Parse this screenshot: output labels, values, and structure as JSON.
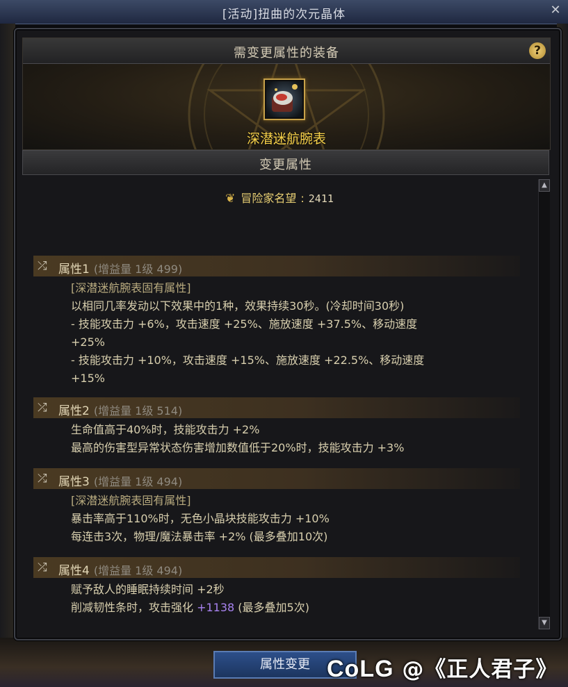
{
  "window": {
    "title": "[活动]扭曲的次元晶体",
    "close_label": "✕"
  },
  "equip_section": {
    "title": "需变更属性的装备",
    "help_label": "?",
    "item_name": "深潜迷航腕表"
  },
  "attr_section": {
    "title": "变更属性"
  },
  "fame": {
    "label": "冒险家名望",
    "separator": ":",
    "value": "2411"
  },
  "attributes": [
    {
      "label": "属性1",
      "extra": "(增益量 1级 499)",
      "lines": [
        "[深潜迷航腕表固有属性]",
        "以相同几率发动以下效果中的1种，效果持续30秒。(冷却时间30秒)",
        "- 技能攻击力 +6%，攻击速度 +25%、施放速度 +37.5%、移动速度",
        "+25%",
        "- 技能攻击力 +10%，攻击速度 +15%、施放速度 +22.5%、移动速度",
        "+15%"
      ]
    },
    {
      "label": "属性2",
      "extra": "(增益量 1级 514)",
      "lines": [
        "生命值高于40%时，技能攻击力 +2%",
        "最高的伤害型异常状态伤害增加数值低于20%时，技能攻击力 +3%"
      ]
    },
    {
      "label": "属性3",
      "extra": "(增益量 1级 494)",
      "lines": [
        "[深潜迷航腕表固有属性]",
        "暴击率高于110%时，无色小晶块技能攻击力 +10%",
        "每连击3次，物理/魔法暴击率 +2% (最多叠加10次)"
      ]
    },
    {
      "label": "属性4",
      "extra": "(增益量 1级 494)",
      "lines": [
        "赋予敌人的睡眠持续时间 +2秒"
      ],
      "last_line": {
        "before": "削减韧性条时，攻击强化 ",
        "highlight": "+1138",
        "after": " (最多叠加5次)"
      }
    }
  ],
  "buttons": {
    "change": "属性变更"
  },
  "watermark": {
    "logo": "CoLG",
    "text": "@《正人君子》"
  },
  "colors": {
    "item_name": "#f6d14a",
    "highlight": "#a883f0",
    "button_bg": "#2d4f8a"
  }
}
